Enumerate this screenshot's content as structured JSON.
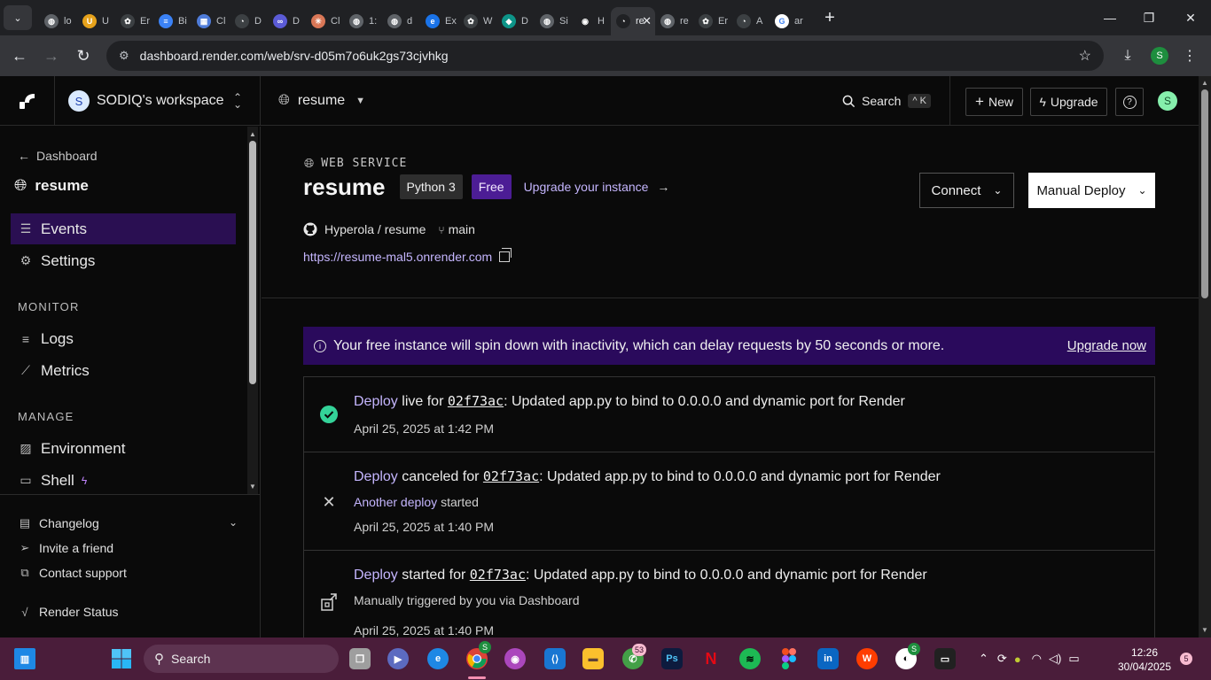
{
  "browser": {
    "tabs": [
      {
        "label": "lo",
        "icon": "globe-icon",
        "color": "#5f6368"
      },
      {
        "label": "U",
        "icon": "udemy-icon",
        "color": "#e6a21b"
      },
      {
        "label": "Er",
        "icon": "openai-icon",
        "color": "#3c4043"
      },
      {
        "label": "Bi",
        "icon": "doc-icon",
        "color": "#3b82f6"
      },
      {
        "label": "Cl",
        "icon": "grid-icon",
        "color": "#4f7cd9"
      },
      {
        "label": "D",
        "icon": "render-icon",
        "color": "#3c4043"
      },
      {
        "label": "D",
        "icon": "fusion-icon",
        "color": "#5b5bd6"
      },
      {
        "label": "Cl",
        "icon": "claude-icon",
        "color": "#d97757"
      },
      {
        "label": "1:",
        "icon": "globe-icon",
        "color": "#5f6368"
      },
      {
        "label": "d",
        "icon": "globe-icon",
        "color": "#5f6368"
      },
      {
        "label": "Ex",
        "icon": "edge-icon",
        "color": "#1a73e8"
      },
      {
        "label": "W",
        "icon": "openai-icon",
        "color": "#3c4043"
      },
      {
        "label": "D",
        "icon": "diamond-icon",
        "color": "#0d9488"
      },
      {
        "label": "Si",
        "icon": "globe-icon",
        "color": "#5f6368"
      },
      {
        "label": "H",
        "icon": "github-icon",
        "color": "#202124"
      },
      {
        "label": "re",
        "icon": "render-icon",
        "color": "#202124",
        "active": true
      },
      {
        "label": "re",
        "icon": "globe-icon",
        "color": "#5f6368"
      },
      {
        "label": "Er",
        "icon": "openai-icon",
        "color": "#3c4043"
      },
      {
        "label": "A",
        "icon": "render-icon",
        "color": "#3c4043"
      },
      {
        "label": "ar",
        "icon": "google-icon",
        "color": "#ffffff"
      }
    ],
    "url": "dashboard.render.com/web/srv-d05m7o6uk2gs73cjvhkg",
    "profile_initial": "S"
  },
  "nav": {
    "workspace_initial": "S",
    "workspace_name": "SODIQ's workspace",
    "project": "resume",
    "search_label": "Search",
    "search_kbd": "^ K",
    "new_label": "New",
    "upgrade_label": "Upgrade",
    "help_label": "?",
    "user_initial": "S"
  },
  "sidebar": {
    "back_label": "Dashboard",
    "service_name": "resume",
    "items": [
      {
        "label": "Events",
        "icon": "list-icon",
        "active": true
      },
      {
        "label": "Settings",
        "icon": "gear-icon"
      }
    ],
    "monitor_title": "MONITOR",
    "monitor_items": [
      {
        "label": "Logs",
        "icon": "logs-icon"
      },
      {
        "label": "Metrics",
        "icon": "chart-icon"
      }
    ],
    "manage_title": "MANAGE",
    "manage_items": [
      {
        "label": "Environment",
        "icon": "env-icon"
      },
      {
        "label": "Shell",
        "icon": "terminal-icon"
      }
    ],
    "footer": [
      {
        "label": "Changelog",
        "icon": "book-icon"
      },
      {
        "label": "Invite a friend",
        "icon": "send-icon"
      },
      {
        "label": "Contact support",
        "icon": "external-icon"
      },
      {
        "label": "Render Status",
        "icon": "pulse-icon"
      }
    ]
  },
  "service": {
    "type": "WEB SERVICE",
    "name": "resume",
    "runtime_badge": "Python 3",
    "plan_badge": "Free",
    "upgrade_link": "Upgrade your instance",
    "repo": "Hyperola / resume",
    "branch": "main",
    "url": "https://resume-mal5.onrender.com",
    "connect_label": "Connect",
    "manual_deploy_label": "Manual Deploy"
  },
  "notice": {
    "text": "Your free instance will spin down with inactivity, which can delay requests by 50 seconds or more.",
    "link": "Upgrade now",
    "bg_color": "#2a0a5c"
  },
  "events": [
    {
      "status": "live",
      "icon": "check-circle-icon",
      "deploy_word": "Deploy",
      "status_text": "live",
      "for_word": "for",
      "commit": "02f73ac",
      "message": ": Updated app.py to bind to 0.0.0.0 and dynamic port for Render",
      "sub": null,
      "time": "April 25, 2025 at 1:42 PM"
    },
    {
      "status": "canceled",
      "icon": "x-icon",
      "deploy_word": "Deploy",
      "status_text": "canceled",
      "for_word": "for",
      "commit": "02f73ac",
      "message": ": Updated app.py to bind to 0.0.0.0 and dynamic port for Render",
      "sub_link": "Another deploy",
      "sub_text": " started",
      "time": "April 25, 2025 at 1:40 PM"
    },
    {
      "status": "started",
      "icon": "deploy-started-icon",
      "deploy_word": "Deploy",
      "status_text": "started",
      "for_word": "for",
      "commit": "02f73ac",
      "message": ": Updated app.py to bind to 0.0.0.0 and dynamic port for Render",
      "sub_text": "Manually triggered by you via Dashboard",
      "time": "April 25, 2025 at 1:40 PM"
    }
  ],
  "taskbar": {
    "search_label": "Search",
    "whatsapp_badge": "53",
    "time": "12:26",
    "date": "30/04/2025",
    "notification_count": "5"
  }
}
